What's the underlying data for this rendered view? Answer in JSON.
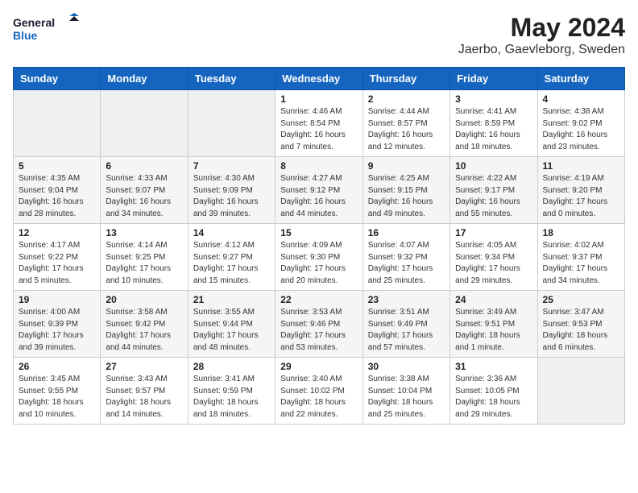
{
  "logo": {
    "line1": "General",
    "line2": "Blue"
  },
  "title": "May 2024",
  "location": "Jaerbo, Gaevleborg, Sweden",
  "days_of_week": [
    "Sunday",
    "Monday",
    "Tuesday",
    "Wednesday",
    "Thursday",
    "Friday",
    "Saturday"
  ],
  "weeks": [
    [
      {
        "day": "",
        "info": ""
      },
      {
        "day": "",
        "info": ""
      },
      {
        "day": "",
        "info": ""
      },
      {
        "day": "1",
        "info": "Sunrise: 4:46 AM\nSunset: 8:54 PM\nDaylight: 16 hours\nand 7 minutes."
      },
      {
        "day": "2",
        "info": "Sunrise: 4:44 AM\nSunset: 8:57 PM\nDaylight: 16 hours\nand 12 minutes."
      },
      {
        "day": "3",
        "info": "Sunrise: 4:41 AM\nSunset: 8:59 PM\nDaylight: 16 hours\nand 18 minutes."
      },
      {
        "day": "4",
        "info": "Sunrise: 4:38 AM\nSunset: 9:02 PM\nDaylight: 16 hours\nand 23 minutes."
      }
    ],
    [
      {
        "day": "5",
        "info": "Sunrise: 4:35 AM\nSunset: 9:04 PM\nDaylight: 16 hours\nand 28 minutes."
      },
      {
        "day": "6",
        "info": "Sunrise: 4:33 AM\nSunset: 9:07 PM\nDaylight: 16 hours\nand 34 minutes."
      },
      {
        "day": "7",
        "info": "Sunrise: 4:30 AM\nSunset: 9:09 PM\nDaylight: 16 hours\nand 39 minutes."
      },
      {
        "day": "8",
        "info": "Sunrise: 4:27 AM\nSunset: 9:12 PM\nDaylight: 16 hours\nand 44 minutes."
      },
      {
        "day": "9",
        "info": "Sunrise: 4:25 AM\nSunset: 9:15 PM\nDaylight: 16 hours\nand 49 minutes."
      },
      {
        "day": "10",
        "info": "Sunrise: 4:22 AM\nSunset: 9:17 PM\nDaylight: 16 hours\nand 55 minutes."
      },
      {
        "day": "11",
        "info": "Sunrise: 4:19 AM\nSunset: 9:20 PM\nDaylight: 17 hours\nand 0 minutes."
      }
    ],
    [
      {
        "day": "12",
        "info": "Sunrise: 4:17 AM\nSunset: 9:22 PM\nDaylight: 17 hours\nand 5 minutes."
      },
      {
        "day": "13",
        "info": "Sunrise: 4:14 AM\nSunset: 9:25 PM\nDaylight: 17 hours\nand 10 minutes."
      },
      {
        "day": "14",
        "info": "Sunrise: 4:12 AM\nSunset: 9:27 PM\nDaylight: 17 hours\nand 15 minutes."
      },
      {
        "day": "15",
        "info": "Sunrise: 4:09 AM\nSunset: 9:30 PM\nDaylight: 17 hours\nand 20 minutes."
      },
      {
        "day": "16",
        "info": "Sunrise: 4:07 AM\nSunset: 9:32 PM\nDaylight: 17 hours\nand 25 minutes."
      },
      {
        "day": "17",
        "info": "Sunrise: 4:05 AM\nSunset: 9:34 PM\nDaylight: 17 hours\nand 29 minutes."
      },
      {
        "day": "18",
        "info": "Sunrise: 4:02 AM\nSunset: 9:37 PM\nDaylight: 17 hours\nand 34 minutes."
      }
    ],
    [
      {
        "day": "19",
        "info": "Sunrise: 4:00 AM\nSunset: 9:39 PM\nDaylight: 17 hours\nand 39 minutes."
      },
      {
        "day": "20",
        "info": "Sunrise: 3:58 AM\nSunset: 9:42 PM\nDaylight: 17 hours\nand 44 minutes."
      },
      {
        "day": "21",
        "info": "Sunrise: 3:55 AM\nSunset: 9:44 PM\nDaylight: 17 hours\nand 48 minutes."
      },
      {
        "day": "22",
        "info": "Sunrise: 3:53 AM\nSunset: 9:46 PM\nDaylight: 17 hours\nand 53 minutes."
      },
      {
        "day": "23",
        "info": "Sunrise: 3:51 AM\nSunset: 9:49 PM\nDaylight: 17 hours\nand 57 minutes."
      },
      {
        "day": "24",
        "info": "Sunrise: 3:49 AM\nSunset: 9:51 PM\nDaylight: 18 hours\nand 1 minute."
      },
      {
        "day": "25",
        "info": "Sunrise: 3:47 AM\nSunset: 9:53 PM\nDaylight: 18 hours\nand 6 minutes."
      }
    ],
    [
      {
        "day": "26",
        "info": "Sunrise: 3:45 AM\nSunset: 9:55 PM\nDaylight: 18 hours\nand 10 minutes."
      },
      {
        "day": "27",
        "info": "Sunrise: 3:43 AM\nSunset: 9:57 PM\nDaylight: 18 hours\nand 14 minutes."
      },
      {
        "day": "28",
        "info": "Sunrise: 3:41 AM\nSunset: 9:59 PM\nDaylight: 18 hours\nand 18 minutes."
      },
      {
        "day": "29",
        "info": "Sunrise: 3:40 AM\nSunset: 10:02 PM\nDaylight: 18 hours\nand 22 minutes."
      },
      {
        "day": "30",
        "info": "Sunrise: 3:38 AM\nSunset: 10:04 PM\nDaylight: 18 hours\nand 25 minutes."
      },
      {
        "day": "31",
        "info": "Sunrise: 3:36 AM\nSunset: 10:05 PM\nDaylight: 18 hours\nand 29 minutes."
      },
      {
        "day": "",
        "info": ""
      }
    ]
  ]
}
